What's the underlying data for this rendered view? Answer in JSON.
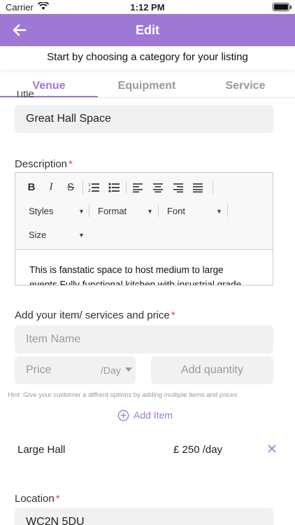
{
  "status_bar": {
    "carrier": "Carrier",
    "time": "1:12 PM"
  },
  "header": {
    "title": "Edit",
    "subtitle": "Start by choosing a category for your listing"
  },
  "tabs": [
    {
      "label": "Venue",
      "active": true
    },
    {
      "label": "Equipment",
      "active": false
    },
    {
      "label": "Service",
      "active": false
    }
  ],
  "form": {
    "title_label_partial": "Title",
    "title_value": "Great Hall Space",
    "description_label": "Description",
    "required_mark": "*",
    "editor": {
      "buttons": [
        "B",
        "I",
        "S"
      ],
      "styles_label": "Styles",
      "format_label": "Format",
      "font_label": "Font",
      "size_label": "Size",
      "content": "This is fanstatic space to host medium to large events.Fully functional kitchen with insustrial grade"
    },
    "items_label": "Add your item/ services and price",
    "item_name_placeholder": "Item Name",
    "price_placeholder": "Price",
    "price_unit": "/Day",
    "quantity_placeholder": "Add quantity",
    "hint": "Hint: Give your customer a diffrent options by adding multiple items and prices",
    "add_item_label": "Add Item",
    "items": [
      {
        "name": "Large Hall",
        "price": "£ 250 /day"
      }
    ],
    "location_label": "Location",
    "location_value": "WC2N 5DU"
  },
  "colors": {
    "accent": "#9f78d6",
    "required": "#e04a4a",
    "field_bg": "#f1f1f1"
  },
  "icons": {
    "back": "arrow-left-icon",
    "add": "plus-circle-icon",
    "remove": "close-icon"
  }
}
